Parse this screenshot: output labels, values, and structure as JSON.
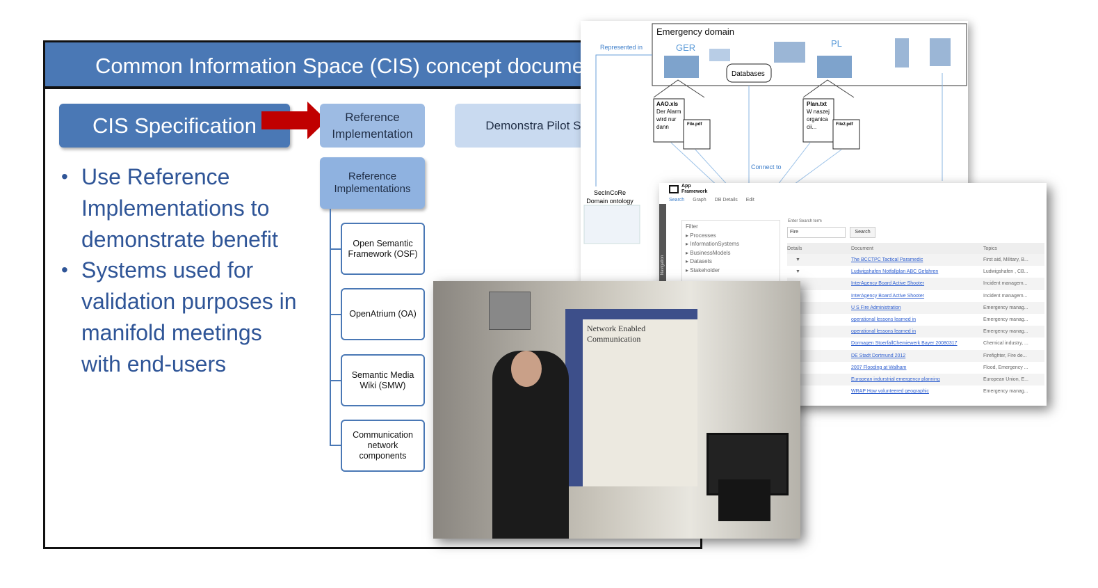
{
  "slide": {
    "title": "Common Information Space (CIS) concept docume",
    "cis_box": "CIS Specification",
    "ref_box": "Reference Implementation",
    "demo_box": "Demonstra Pilot Stu",
    "ref_impls": "Reference Implementations",
    "components": [
      "Open Semantic Framework (OSF)",
      "OpenAtrium (OA)",
      "Semantic Media Wiki (SMW)",
      "Communication network components"
    ],
    "bullets": [
      "Use Reference Implementations to demonstrate benefit",
      "Systems used for validation purposes in manifold meetings with end-users"
    ],
    "arrow_color": "#c00000",
    "accent": "#4a78b5"
  },
  "diagram": {
    "title": "Emergency domain",
    "represented": "Represented in",
    "ger": "GER",
    "pl": "PL",
    "databases": "Databases",
    "connect": "Connect to",
    "ontology": "SecInCoRe Domain ontology",
    "doc1": {
      "name": "AAO.xls",
      "text": "Der Alarm wird nur dann",
      "file": "File.pdf"
    },
    "doc2": {
      "name": "Plan.txt",
      "text": "W naszej organica cii...",
      "file": "File2.pdf"
    }
  },
  "app": {
    "name": "App Framework",
    "tabs": [
      "Search",
      "Graph",
      "DB Details",
      "Edit"
    ],
    "filter": "Filter",
    "filter_items": [
      "Processes",
      "InformationSystems",
      "BusinessModels",
      "Datasets",
      "Stakeholder"
    ],
    "nav": "Navigation",
    "search_label": "Enter Search term",
    "search_value": "Fire",
    "search_button": "Search",
    "columns": [
      "Details",
      "Document",
      "Topics"
    ],
    "rows": [
      [
        "The BCCTPC Tactical Paramedic",
        "First aid, Military, B..."
      ],
      [
        "Ludwigshafen Notfallplan ABC Gefahren",
        "Ludwigshafen , CB..."
      ],
      [
        "InterAgency Board Active Shooter",
        "Incident managem..."
      ],
      [
        "InterAgency Board Active Shooter",
        "Incident managem..."
      ],
      [
        "U S Fire Administration",
        "Emergency manag..."
      ],
      [
        "operational lessons learned in",
        "Emergency manag..."
      ],
      [
        "operational lessons learned in",
        "Emergency manag..."
      ],
      [
        "Dormagen StoerfallChemiewerk Bayer 20080317",
        "Chemical industry, ..."
      ],
      [
        "DE Stadt Dortmund 2012",
        "Firefighter, Fire de..."
      ],
      [
        "2007 Flooding at Walham",
        "Flood, Emergency ..."
      ],
      [
        "European indurstrial emergency planning",
        "European Union, E..."
      ],
      [
        "WRAP How volunteered geographic",
        "Emergency manag..."
      ]
    ]
  },
  "photo": {
    "poster_title": "Network Enabled Communication"
  }
}
